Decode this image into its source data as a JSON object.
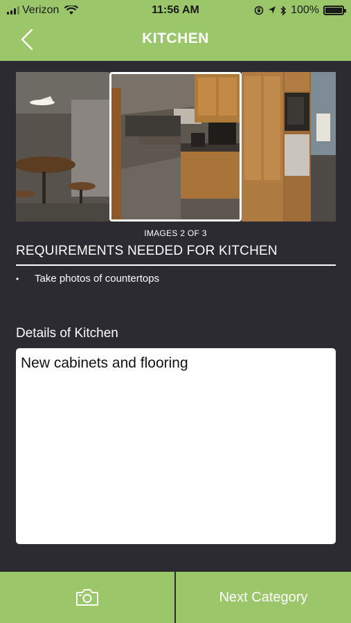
{
  "status_bar": {
    "carrier": "Verizon",
    "time": "11:56 AM",
    "battery": "100%"
  },
  "nav": {
    "title": "KITCHEN",
    "back_icon": "chevron-left-icon"
  },
  "gallery": {
    "counter": "IMAGES 2 OF 3",
    "selected_index": 2,
    "total": 3
  },
  "requirements": {
    "title": "REQUIREMENTS NEEDED FOR KITCHEN",
    "items": [
      "Take photos of countertops"
    ]
  },
  "details": {
    "label": "Details of Kitchen",
    "value": "New cabinets and flooring"
  },
  "bottom_bar": {
    "camera_icon": "camera-icon",
    "next_label": "Next Category"
  },
  "colors": {
    "accent": "#9cc66a",
    "background": "#2b2b31"
  }
}
